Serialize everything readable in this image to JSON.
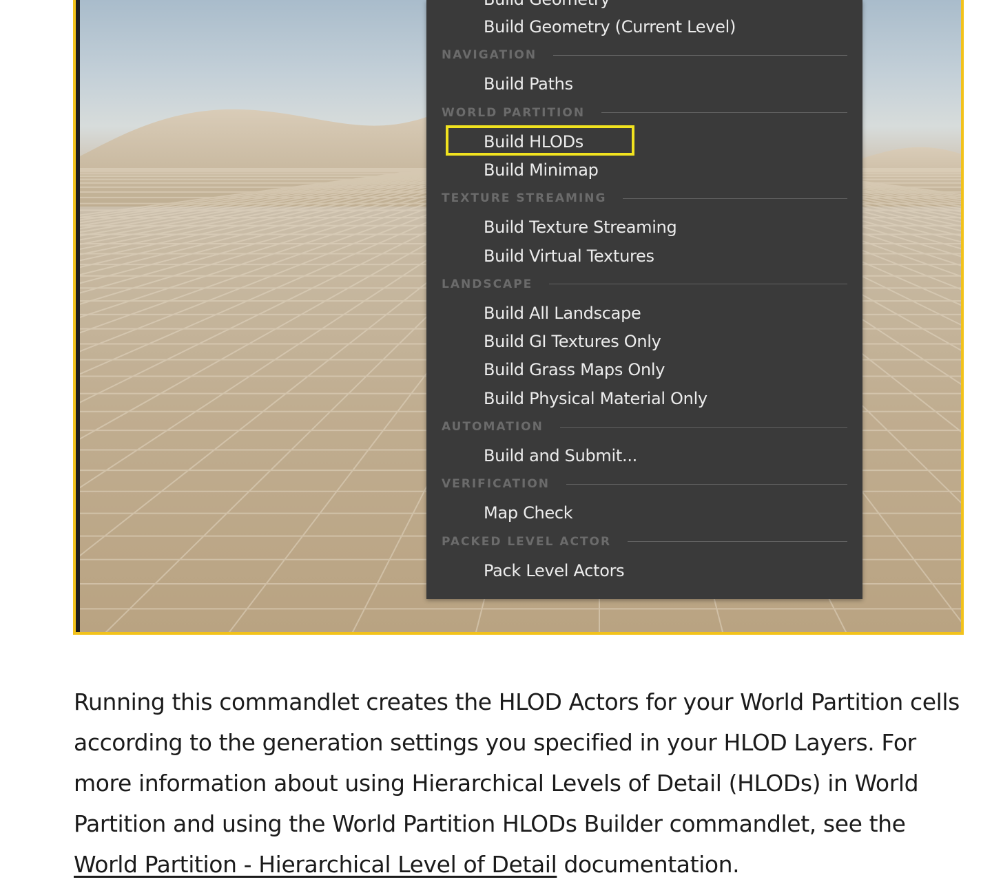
{
  "menu": {
    "clipped_item": "Build Geometry",
    "sections": [
      {
        "items": [
          "Build Geometry (Current Level)"
        ]
      },
      {
        "label": "NAVIGATION",
        "items": [
          "Build Paths"
        ]
      },
      {
        "label": "WORLD PARTITION",
        "items": [
          "Build HLODs",
          "Build Minimap"
        ]
      },
      {
        "label": "TEXTURE STREAMING",
        "items": [
          "Build Texture Streaming",
          "Build Virtual Textures"
        ]
      },
      {
        "label": "LANDSCAPE",
        "items": [
          "Build All Landscape",
          "Build GI Textures Only",
          "Build Grass Maps Only",
          "Build Physical Material Only"
        ]
      },
      {
        "label": "AUTOMATION",
        "items": [
          "Build and Submit..."
        ]
      },
      {
        "label": "VERIFICATION",
        "items": [
          "Map Check"
        ]
      },
      {
        "label": "PACKED LEVEL ACTOR",
        "items": [
          "Pack Level Actors"
        ]
      }
    ],
    "highlighted_item": "Build HLODs"
  },
  "colors": {
    "figure_border": "#f2c21b",
    "highlight": "#f1e31f",
    "menu_bg": "#3a3a3a"
  },
  "body": {
    "text_before_link": "Running this commandlet creates the HLOD Actors for your World Partition cells according to the generation settings you specified in your HLOD Layers. For more information about using Hierarchical Levels of Detail (HLODs) in World Partition and using the World Partition HLODs Builder commandlet, see the ",
    "link_text": "World Partition - Hierarchical Level of Detail",
    "text_after_link": " documentation."
  }
}
